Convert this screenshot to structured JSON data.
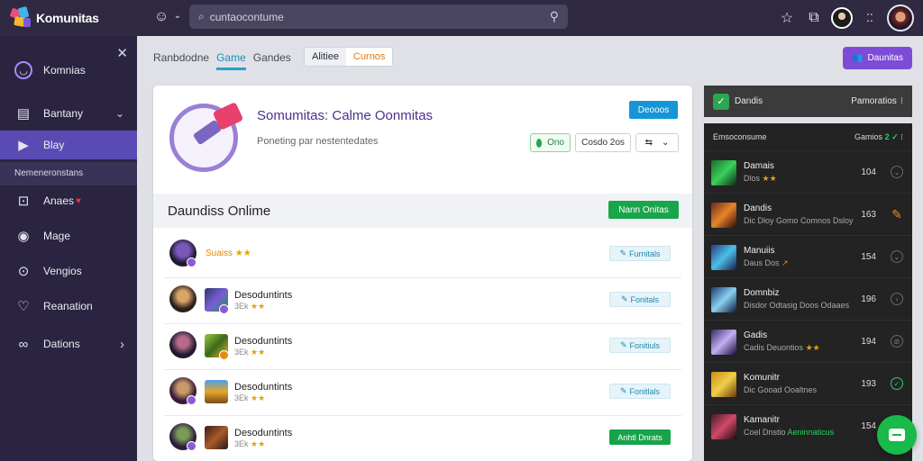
{
  "app": {
    "logo_text": "Komunitas"
  },
  "topbar": {
    "search_placeholder": "cuntaocontume",
    "icons": [
      "help-icon",
      "chevron-down-icon",
      "search-icon",
      "star-icon",
      "notification-icon",
      "more-icon"
    ]
  },
  "sidebar": {
    "items": [
      {
        "label": "Komnias",
        "icon": "smile-icon"
      },
      {
        "label": "Bantany",
        "icon": "wallet-icon",
        "chevron": "⌄"
      },
      {
        "label": "Blay",
        "icon": "play-icon"
      },
      {
        "label": "Anaes",
        "icon": "people-icon"
      },
      {
        "label": "Mage",
        "icon": "check-circle-icon"
      },
      {
        "label": "Vengios",
        "icon": "coin-icon"
      },
      {
        "label": "Reanation",
        "icon": "heart-icon"
      },
      {
        "label": "Dations",
        "icon": "link-icon",
        "chevron": "›"
      }
    ],
    "subheader": "Nemeneronstans"
  },
  "breadcrumb": {
    "tabs": [
      "Ranbdodne",
      "Game",
      "Gandes"
    ],
    "active_index": 1
  },
  "segment": {
    "options": [
      "Alitiee",
      "Curnos"
    ]
  },
  "top_action": {
    "label": "Daunitas"
  },
  "game": {
    "title": "Somumitas: Calme Oonmitas",
    "subtitle": "Poneting par nestentedates",
    "primary_button": "Deooos",
    "status_button": "Ono",
    "mid_button": "Cosdo 2os",
    "share_glyph": "⇆"
  },
  "section": {
    "title": "Daundiss Onlime",
    "action_label": "Nann Onitas"
  },
  "rows": [
    {
      "name": "",
      "meta": "Suaiss",
      "stars": "★★",
      "button": "Furnitals",
      "button_style": "light",
      "thumb_color": ""
    },
    {
      "name": "Desoduntints",
      "meta": "3Ek",
      "stars": "★★",
      "button": "Fonitals",
      "button_style": "light",
      "thumb_color": "#2a3a6a",
      "thumb_badge": "#8a5bd6"
    },
    {
      "name": "Desoduntints",
      "meta": "3Ek",
      "stars": "★★",
      "button": "Fonitiuls",
      "button_style": "light",
      "thumb_color": "#5a8a2a",
      "thumb_badge": "#e88a12"
    },
    {
      "name": "Desoduntints",
      "meta": "3Ek",
      "stars": "★★",
      "button": "Fonitlals",
      "button_style": "light",
      "thumb_color": "#c98a2a",
      "thumb_badge": ""
    },
    {
      "name": "Desoduntints",
      "meta": "3Ek",
      "stars": "★★",
      "button": "Anhtl Dnrats",
      "button_style": "green",
      "thumb_color": "#6a3a2a",
      "thumb_badge": ""
    }
  ],
  "right_panel": {
    "title": "Dandis",
    "title_right": "Pamoratios",
    "sub_left": "Emsoconsume",
    "sub_right_prefix": "Gamios",
    "sub_right_mark": "2 ✓",
    "rows": [
      {
        "name": "Damais",
        "meta": "Dlos",
        "stars": "★★",
        "extra": "",
        "num": "104",
        "icon": "⌄",
        "icon_style": "",
        "thumb": "#1a6a2a"
      },
      {
        "name": "Dandis",
        "meta": "Dic Dloy",
        "stars": "",
        "extra": "Gomo Comnos Dsloy",
        "num": "163",
        "icon": "✎",
        "icon_style": "orange",
        "thumb": "#6a2a1a"
      },
      {
        "name": "Manuiis",
        "meta": "Daus Dos",
        "stars": "↗",
        "extra": "",
        "num": "154",
        "icon": "⌄",
        "icon_style": "",
        "thumb": "#2a3a8a"
      },
      {
        "name": "Domnbiz",
        "meta": "Disdor Odtasig",
        "stars": "",
        "extra": "Doos Odaaes",
        "num": "196",
        "icon": "›",
        "icon_style": "",
        "thumb": "#1a3a6a"
      },
      {
        "name": "Gadis",
        "meta": "Cadis Deuontios",
        "stars": "★★",
        "extra": "",
        "num": "194",
        "icon": "⊘",
        "icon_style": "",
        "thumb": "#3a2a6a"
      },
      {
        "name": "Komunitr",
        "meta": "Dic Gooad Ooaltnes",
        "stars": "",
        "extra": "",
        "num": "193",
        "icon": "✓",
        "icon_style": "green",
        "thumb": "#c98a1a"
      },
      {
        "name": "Kamanitr",
        "meta": "Coel Dnstio",
        "stars": "",
        "extra": "Aeninnaticus",
        "num": "154",
        "icon": "",
        "icon_style": "",
        "thumb": "#4a1a2a"
      }
    ]
  },
  "colors": {
    "accent": "#7e4bd6",
    "topbar": "#2f2941",
    "sidebar": "#2a2440",
    "active": "#5a4bb4",
    "green": "#19a64a",
    "blue": "#1596d6"
  }
}
